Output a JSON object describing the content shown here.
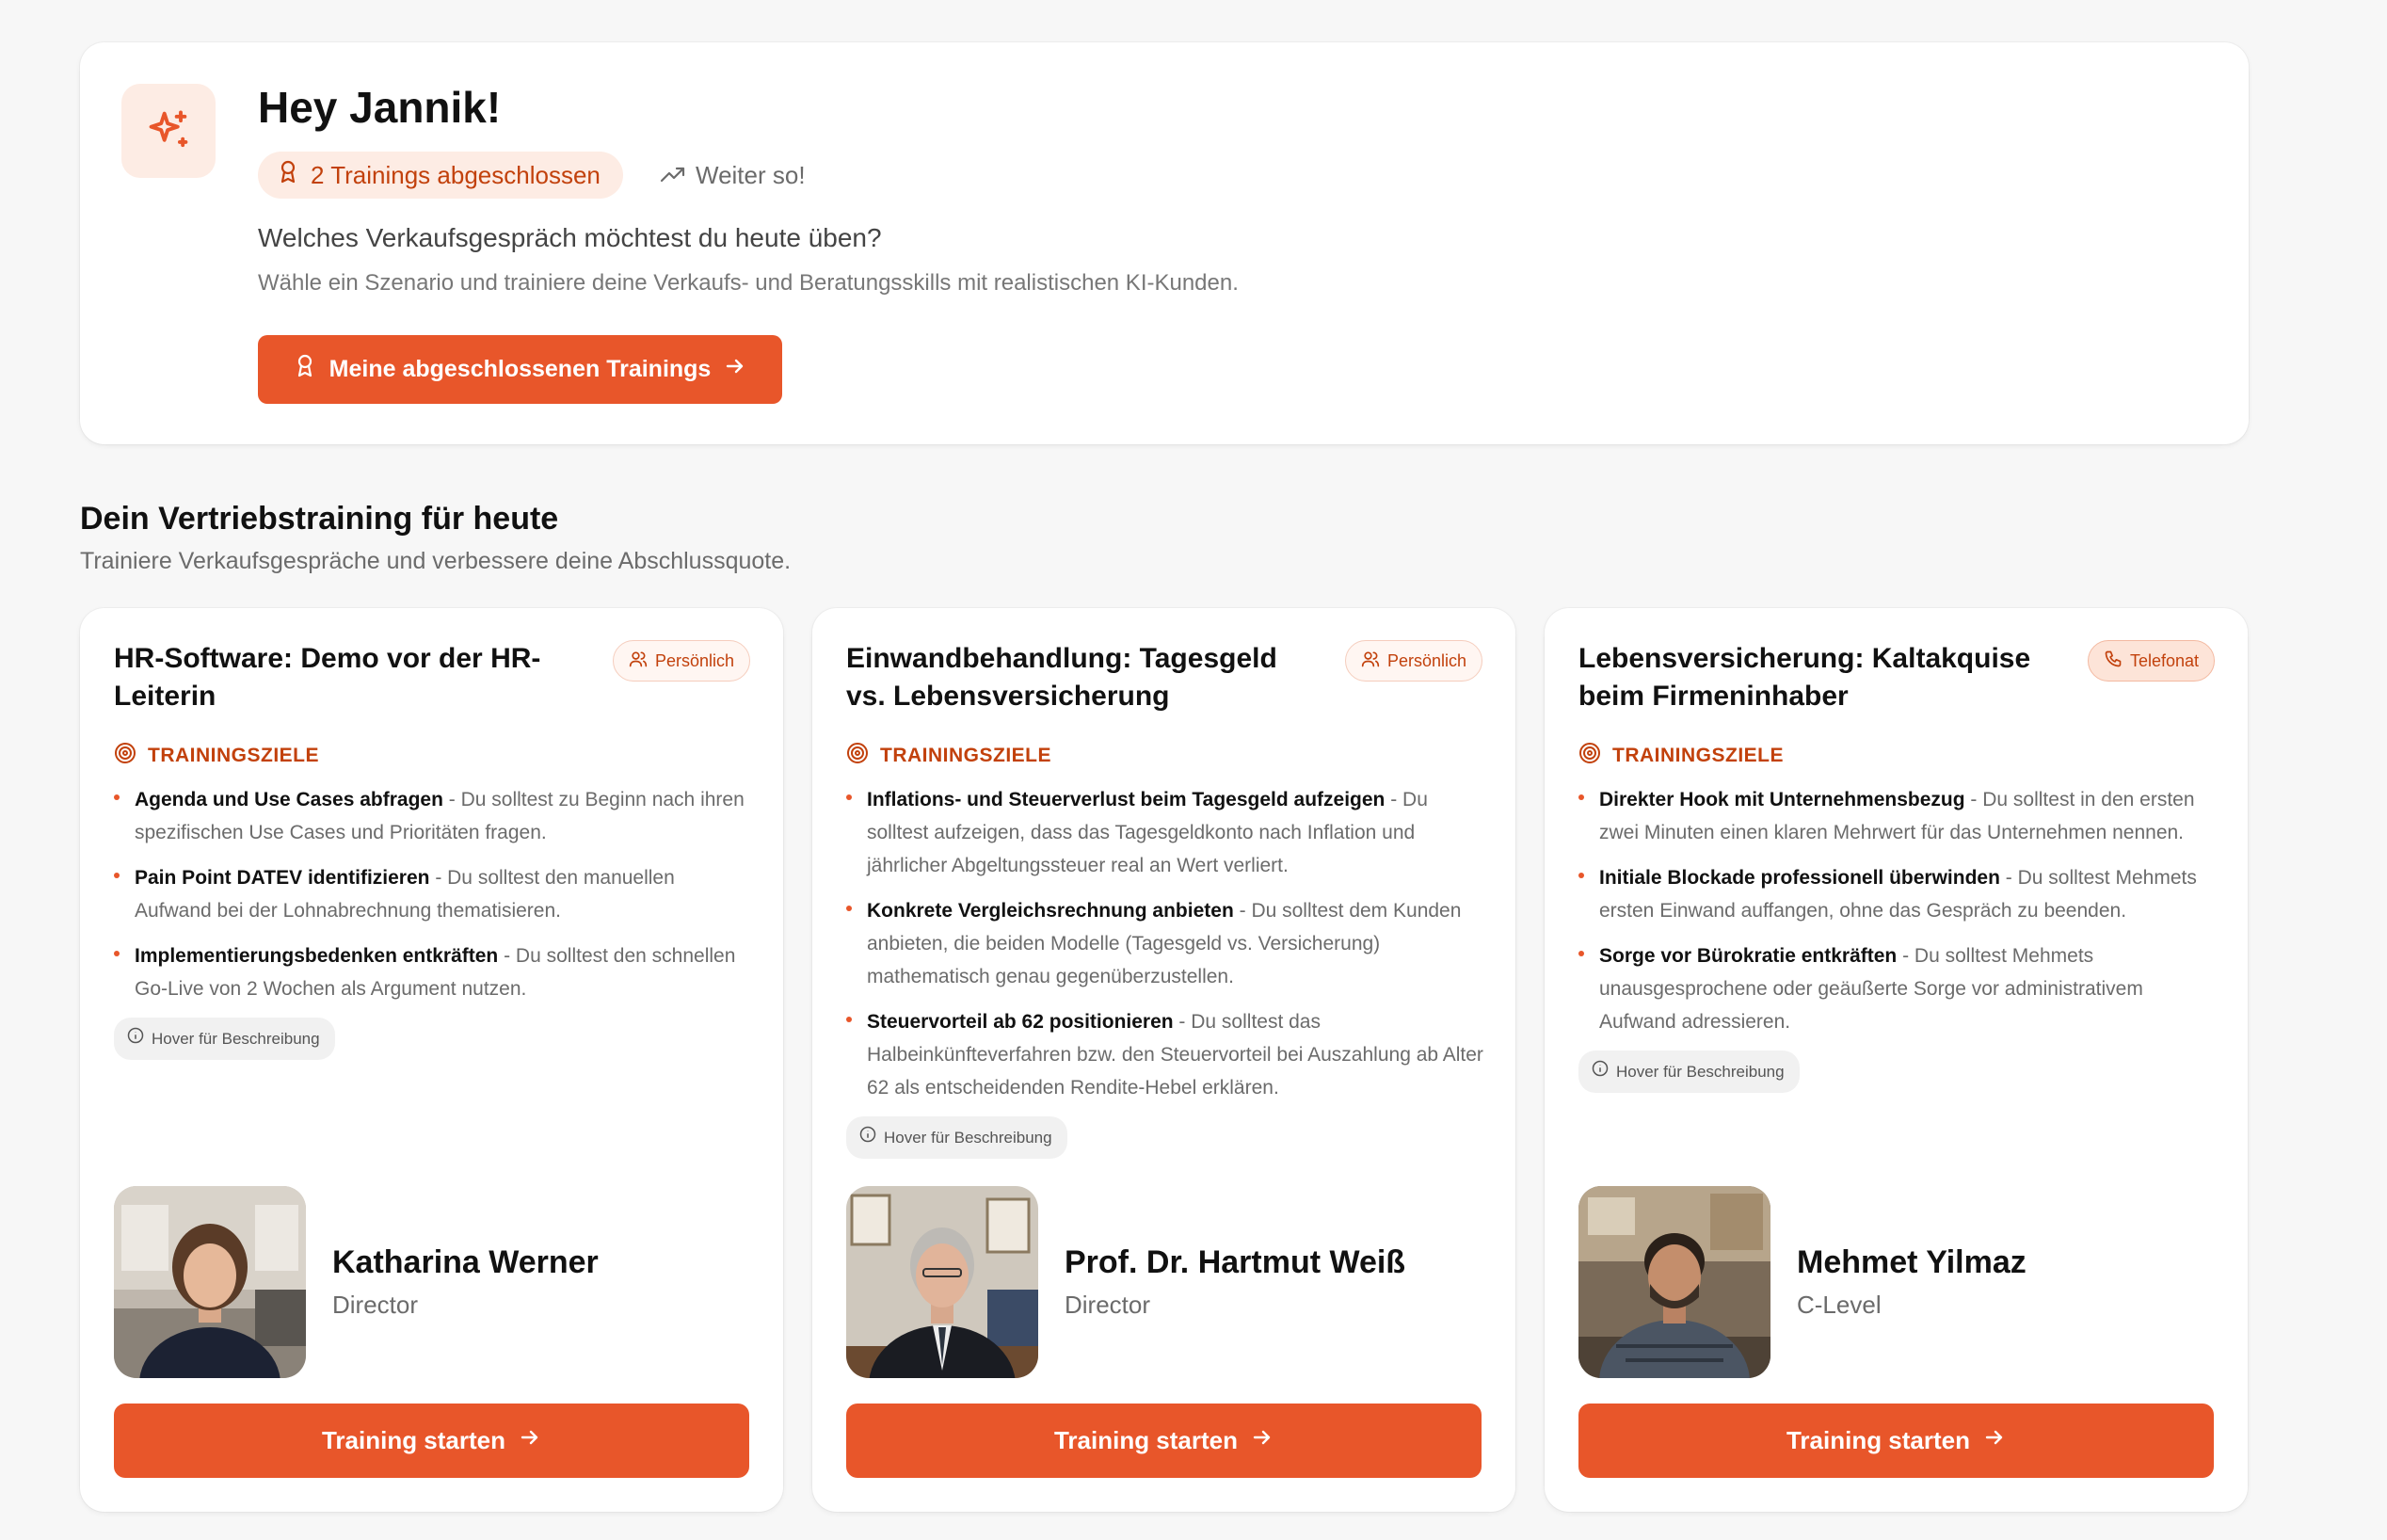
{
  "colors": {
    "accent": "#e8562a",
    "accent_text": "#c2410c",
    "accent_soft": "#fdece4"
  },
  "welcome": {
    "icon": "sparkles-icon",
    "greeting": "Hey Jannik!",
    "completed_badge": "2 Trainings abgeschlossen",
    "keep_up": "Weiter so!",
    "question": "Welches Verkaufsgespräch möchtest du heute üben?",
    "description": "Wähle ein Szenario und trainiere deine Verkaufs- und Beratungsskills mit realistischen KI-Kunden.",
    "button_label": "Meine abgeschlossenen Trainings"
  },
  "section": {
    "title": "Dein Vertriebstraining für heute",
    "subtitle": "Trainiere Verkaufsgespräche und verbessere deine Abschlussquote."
  },
  "cards": [
    {
      "title": "HR-Software: Demo vor der HR-Leiterin",
      "mode": "Persönlich",
      "goals_heading": "TRAININGSZIELE",
      "goals": [
        {
          "title": "Agenda und Use Cases abfragen",
          "text": " - Du solltest zu Beginn nach ihren spezifischen Use Cases und Prioritäten fragen."
        },
        {
          "title": "Pain Point DATEV identifizieren",
          "text": " - Du solltest den manuellen Aufwand bei der Lohnabrechnung thematisieren."
        },
        {
          "title": "Implementierungsbedenken entkräften",
          "text": " - Du solltest den schnellen Go-Live von 2 Wochen als Argument nutzen."
        }
      ],
      "hover_hint": "Hover für Beschreibung",
      "person": {
        "name": "Katharina Werner",
        "role": "Director"
      },
      "button_label": "Training starten"
    },
    {
      "title": "Einwandbehandlung: Tagesgeld vs. Lebensversicherung",
      "mode": "Persönlich",
      "goals_heading": "TRAININGSZIELE",
      "goals": [
        {
          "title": "Inflations- und Steuerverlust beim Tagesgeld aufzeigen",
          "text": " - Du solltest aufzeigen, dass das Tagesgeldkonto nach Inflation und jährlicher Abgeltungssteuer real an Wert verliert."
        },
        {
          "title": "Konkrete Vergleichsrechnung anbieten",
          "text": " - Du solltest dem Kunden anbieten, die beiden Modelle (Tagesgeld vs. Versicherung) mathematisch genau gegenüberzustellen."
        },
        {
          "title": "Steuervorteil ab 62 positionieren",
          "text": " - Du solltest das Halbeinkünfteverfahren bzw. den Steuervorteil bei Auszahlung ab Alter 62 als entscheidenden Rendite-Hebel erklären."
        }
      ],
      "hover_hint": "Hover für Beschreibung",
      "person": {
        "name": "Prof. Dr. Hartmut Weiß",
        "role": "Director"
      },
      "button_label": "Training starten"
    },
    {
      "title": "Lebensversicherung: Kaltakquise beim Firmeninhaber",
      "mode": "Telefonat",
      "goals_heading": "TRAININGSZIELE",
      "goals": [
        {
          "title": "Direkter Hook mit Unternehmensbezug",
          "text": " - Du solltest in den ersten zwei Minuten einen klaren Mehrwert für das Unternehmen nennen."
        },
        {
          "title": "Initiale Blockade professionell überwinden",
          "text": " - Du solltest Mehmets ersten Einwand auffangen, ohne das Gespräch zu beenden."
        },
        {
          "title": "Sorge vor Bürokratie entkräften",
          "text": " - Du solltest Mehmets unausgesprochene oder geäußerte Sorge vor administrativem Aufwand adressieren."
        }
      ],
      "hover_hint": "Hover für Beschreibung",
      "person": {
        "name": "Mehmet Yilmaz",
        "role": "C-Level"
      },
      "button_label": "Training starten"
    }
  ]
}
